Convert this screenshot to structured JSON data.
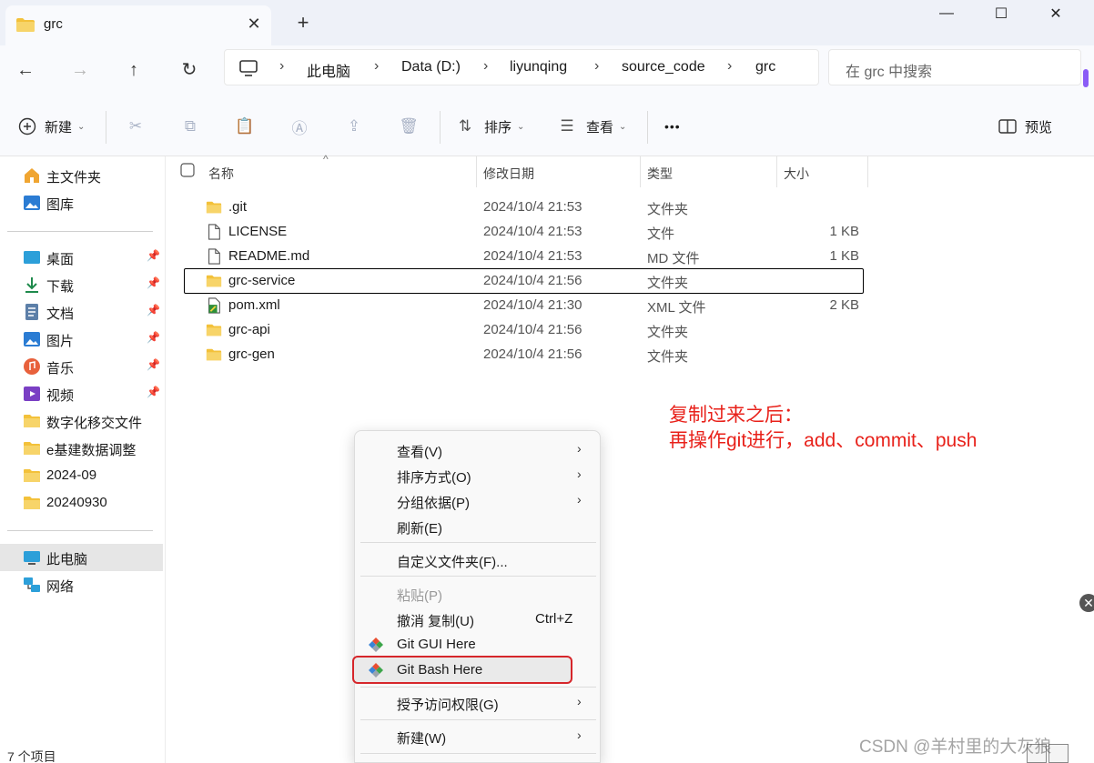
{
  "tab": {
    "title": "grc",
    "close": "✕",
    "new": "+"
  },
  "window": {
    "minimize": "—",
    "maximize": "☐",
    "close": "✕"
  },
  "nav": {
    "back": "←",
    "forward": "→",
    "up": "↑",
    "refresh": "↻"
  },
  "breadcrumb": {
    "items": [
      "此电脑",
      "Data (D:)",
      "liyunqing",
      "source_code",
      "grc"
    ],
    "separator": "›"
  },
  "search": {
    "placeholder": "在 grc 中搜索"
  },
  "toolbar": {
    "new_label": "新建",
    "sort_label": "排序",
    "view_label": "查看",
    "more": "•••",
    "preview_label": "预览"
  },
  "sidebar": {
    "home": "主文件夹",
    "gallery": "图库",
    "items": [
      {
        "label": "桌面",
        "icon": "desktop-icon",
        "pinned": true
      },
      {
        "label": "下载",
        "icon": "download-icon",
        "pinned": true
      },
      {
        "label": "文档",
        "icon": "document-icon",
        "pinned": true
      },
      {
        "label": "图片",
        "icon": "pictures-icon",
        "pinned": true
      },
      {
        "label": "音乐",
        "icon": "music-icon",
        "pinned": true
      },
      {
        "label": "视频",
        "icon": "video-icon",
        "pinned": true
      },
      {
        "label": "数字化移交文件",
        "icon": "folder-icon",
        "pinned": false
      },
      {
        "label": "e基建数据调整",
        "icon": "folder-icon",
        "pinned": false
      },
      {
        "label": "2024-09",
        "icon": "folder-icon",
        "pinned": false
      },
      {
        "label": "20240930",
        "icon": "folder-icon",
        "pinned": false
      }
    ],
    "this_pc": "此电脑",
    "network": "网络"
  },
  "status": {
    "count": "7 个项目"
  },
  "columns": {
    "name": "名称",
    "modified": "修改日期",
    "type": "类型",
    "size": "大小",
    "sort_indicator": "^"
  },
  "files": [
    {
      "name": ".git",
      "modified": "2024/10/4 21:53",
      "type": "文件夹",
      "size": "",
      "icon": "folder-icon"
    },
    {
      "name": "LICENSE",
      "modified": "2024/10/4 21:53",
      "type": "文件",
      "size": "1 KB",
      "icon": "file-icon"
    },
    {
      "name": "README.md",
      "modified": "2024/10/4 21:53",
      "type": "MD 文件",
      "size": "1 KB",
      "icon": "file-icon"
    },
    {
      "name": "grc-service",
      "modified": "2024/10/4 21:56",
      "type": "文件夹",
      "size": "",
      "icon": "folder-icon"
    },
    {
      "name": "pom.xml",
      "modified": "2024/10/4 21:30",
      "type": "XML 文件",
      "size": "2 KB",
      "icon": "xml-file-icon"
    },
    {
      "name": "grc-api",
      "modified": "2024/10/4 21:56",
      "type": "文件夹",
      "size": "",
      "icon": "folder-icon"
    },
    {
      "name": "grc-gen",
      "modified": "2024/10/4 21:56",
      "type": "文件夹",
      "size": "",
      "icon": "folder-icon"
    }
  ],
  "annotation": {
    "line1": "复制过来之后：",
    "line2": "再操作git进行，add、commit、push"
  },
  "context_menu": {
    "view": "查看(V)",
    "sort": "排序方式(O)",
    "group": "分组依据(P)",
    "refresh": "刷新(E)",
    "customize": "自定义文件夹(F)...",
    "paste": "粘贴(P)",
    "undo": "撤消 复制(U)",
    "undo_shortcut": "Ctrl+Z",
    "git_gui": "Git GUI Here",
    "git_bash": "Git Bash Here",
    "grant_access": "授予访问权限(G)",
    "new": "新建(W)",
    "arrow": "›"
  },
  "watermark": "CSDN @羊村里的大灰狼",
  "colors": {
    "accent": "#0067c0",
    "annotation": "#e8211a",
    "folder": "#f3c13a"
  }
}
